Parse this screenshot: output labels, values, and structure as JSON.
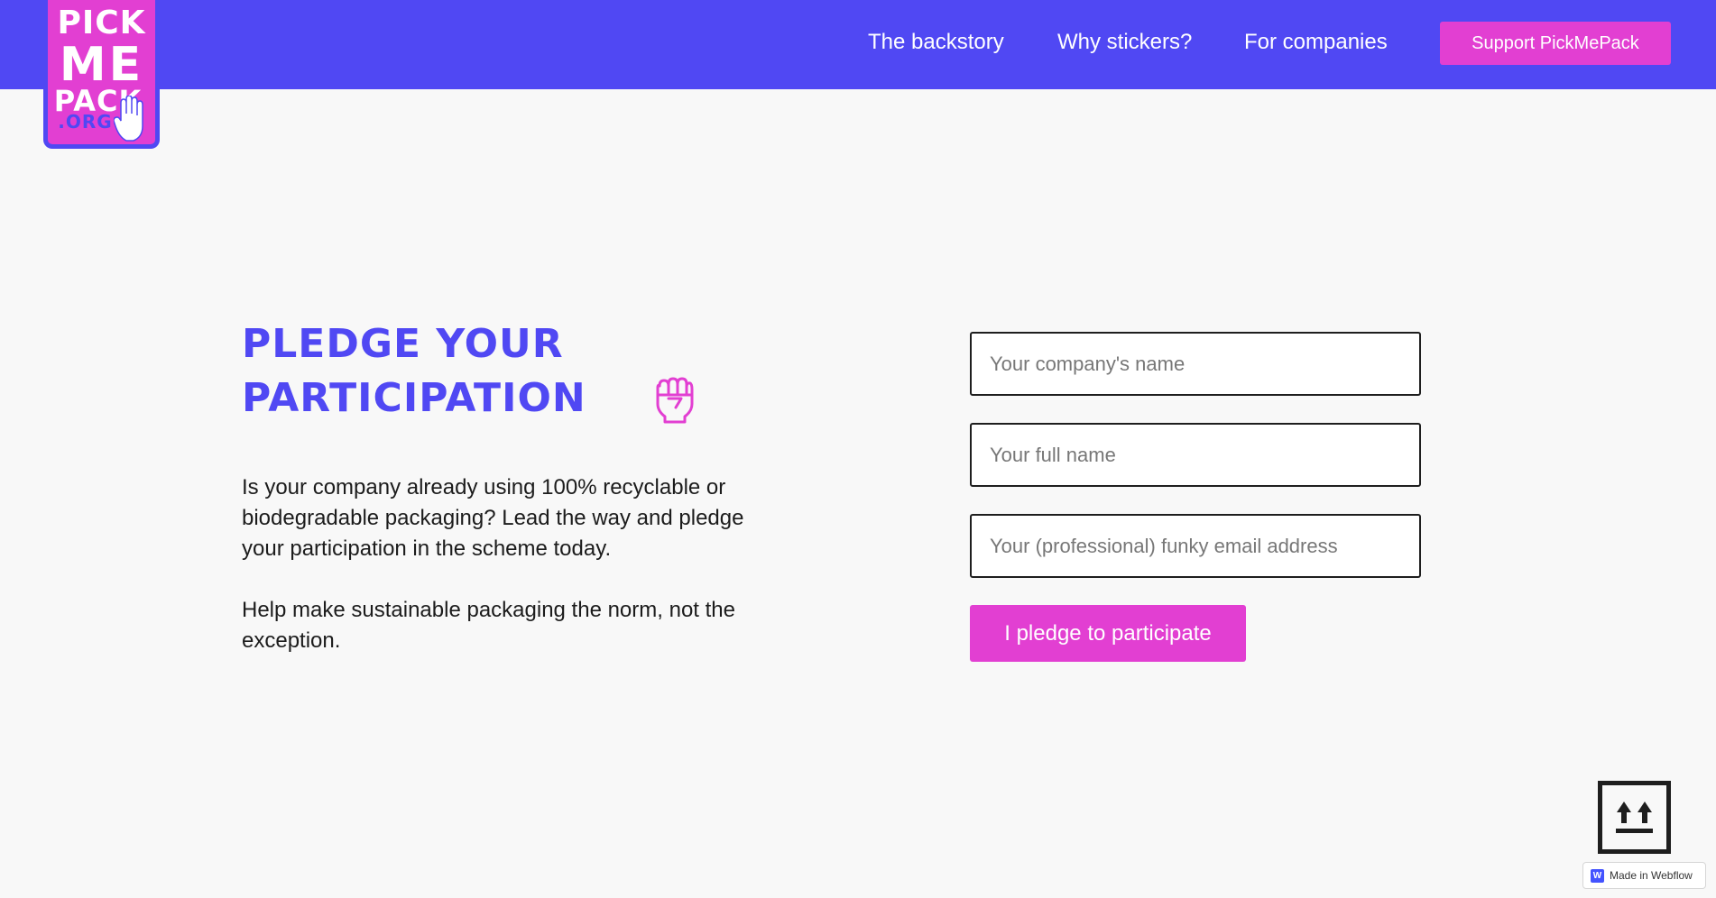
{
  "brand": {
    "logo_lines": [
      "PICK",
      "ME",
      "PACK",
      ".ORG"
    ],
    "colors": {
      "primary": "#5048f3",
      "accent": "#e23fd2",
      "background": "#f8f8f8",
      "text": "#1c1c1c"
    }
  },
  "nav": {
    "links": [
      {
        "label": "The backstory"
      },
      {
        "label": "Why stickers?"
      },
      {
        "label": "For companies"
      }
    ],
    "support_button": "Support PickMePack"
  },
  "pledge": {
    "title_line1": "Pledge your",
    "title_line2": "participation",
    "icon": "raised-fist-icon",
    "paragraph1": "Is your company already using 100% recyclable or biodegradable packaging? Lead the way and pledge your participation in the scheme today.",
    "paragraph2": "Help make sustainable packaging the norm, not the exception."
  },
  "form": {
    "company_placeholder": "Your company's name",
    "name_placeholder": "Your full name",
    "email_placeholder": "Your (professional) funky email address",
    "submit_label": "I pledge to participate"
  },
  "footer": {
    "scroll_icon": "this-way-up-icon",
    "badge_logo": "W",
    "badge_text": "Made in Webflow"
  }
}
